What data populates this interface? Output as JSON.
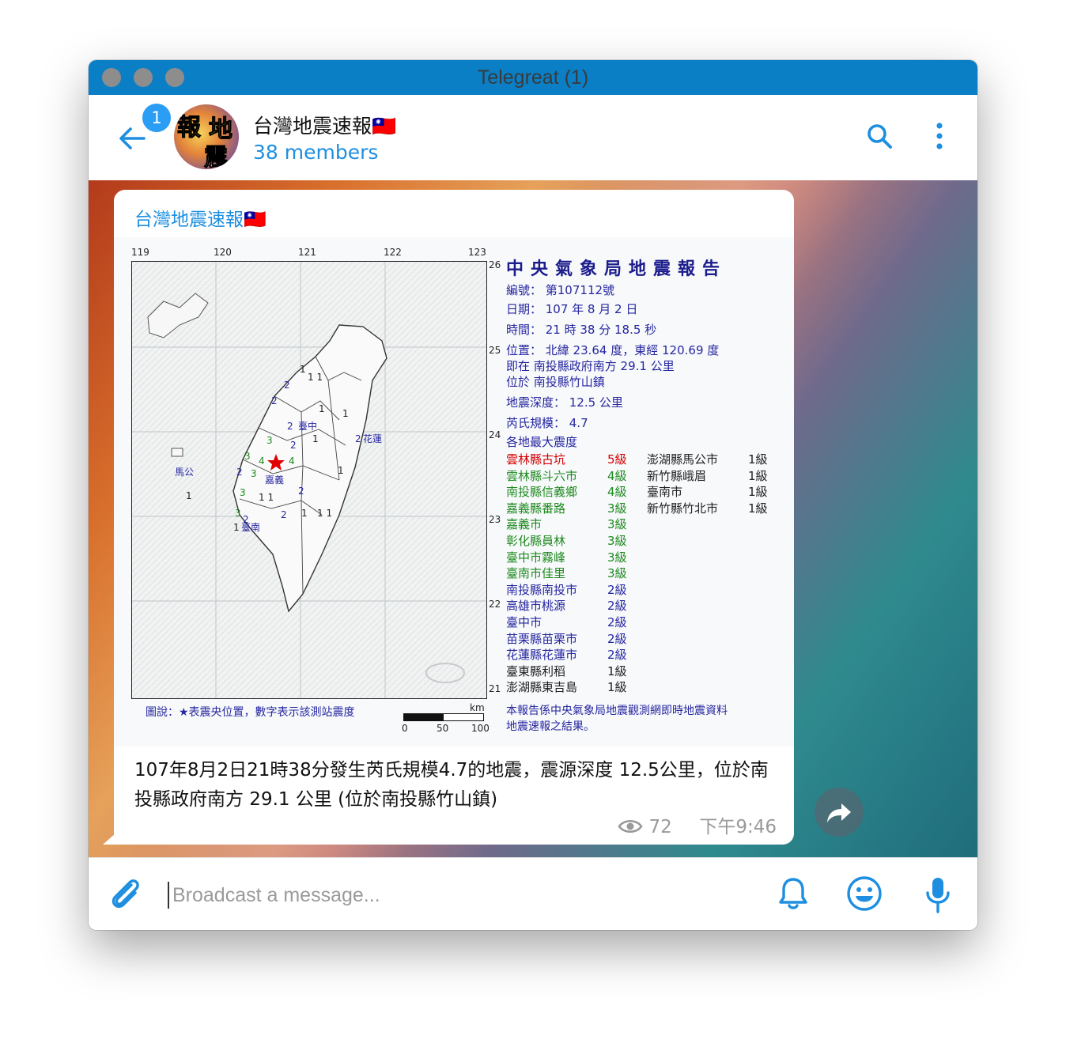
{
  "window": {
    "title": "Telegreat (1)"
  },
  "header": {
    "unread_badge": "1",
    "chat_name": "台灣地震速報🇹🇼",
    "members": "38 members",
    "avatar_chars": [
      "報",
      "地",
      "震"
    ]
  },
  "message": {
    "sender": "台灣地震速報🇹🇼",
    "caption": "107年8月2日21時38分發生芮氏規模4.7的地震，震源深度 12.5公里，位於南投縣政府南方  29.1  公里 (位於南投縣竹山鎮)",
    "views": "72",
    "time": "下午9:46"
  },
  "report": {
    "title": "中央氣象局地震報告",
    "lon_ticks": [
      "119",
      "120",
      "121",
      "122",
      "123"
    ],
    "lat_ticks": [
      "26",
      "25",
      "24",
      "23",
      "22",
      "21"
    ],
    "number": "編號：  第107112號",
    "date": "日期：  107  年  8  月  2  日",
    "time": "時間：  21  時  38  分  18.5  秒",
    "position": "位置：  北緯  23.64  度，東經  120.69  度",
    "position2": "即在  南投縣政府南方  29.1  公里",
    "position3": "位於  南投縣竹山鎮",
    "depth": "地震深度：  12.5  公里",
    "magnitude": "芮氏規模：  4.7",
    "intensity_heading": "各地最大震度",
    "intensities_left": [
      {
        "place": "雲林縣古坑",
        "level": "5級",
        "color": "#d40000"
      },
      {
        "place": "雲林縣斗六市",
        "level": "4級",
        "color": "#1f8a1f"
      },
      {
        "place": "南投縣信義鄉",
        "level": "4級",
        "color": "#1f8a1f"
      },
      {
        "place": "嘉義縣番路",
        "level": "3級",
        "color": "#1f8a1f"
      },
      {
        "place": "嘉義市",
        "level": "3級",
        "color": "#1f8a1f"
      },
      {
        "place": "彰化縣員林",
        "level": "3級",
        "color": "#1f8a1f"
      },
      {
        "place": "臺中市霧峰",
        "level": "3級",
        "color": "#1f8a1f"
      },
      {
        "place": "臺南市佳里",
        "level": "3級",
        "color": "#1f8a1f"
      },
      {
        "place": "南投縣南投市",
        "level": "2級",
        "color": "#2626a0"
      },
      {
        "place": "高雄市桃源",
        "level": "2級",
        "color": "#2626a0"
      },
      {
        "place": "臺中市",
        "level": "2級",
        "color": "#2626a0"
      },
      {
        "place": "苗栗縣苗栗市",
        "level": "2級",
        "color": "#2626a0"
      },
      {
        "place": "花蓮縣花蓮市",
        "level": "2級",
        "color": "#2626a0"
      },
      {
        "place": "臺東縣利稻",
        "level": "1級",
        "color": "#222222"
      },
      {
        "place": "澎湖縣東吉島",
        "level": "1級",
        "color": "#222222"
      }
    ],
    "intensities_right": [
      {
        "place": "澎湖縣馬公市",
        "level": "1級",
        "color": "#222222"
      },
      {
        "place": "新竹縣峨眉",
        "level": "1級",
        "color": "#222222"
      },
      {
        "place": "臺南市",
        "level": "1級",
        "color": "#222222"
      },
      {
        "place": "新竹縣竹北市",
        "level": "1級",
        "color": "#222222"
      }
    ],
    "legend": "圖說：★表震央位置，數字表示該測站震度",
    "scale_unit": "km",
    "scale_ticks": [
      "0",
      "50",
      "100"
    ],
    "footnote1": "本報告係中央氣象局地震觀測網即時地震資料",
    "footnote2": "地震速報之結果。",
    "map_labels": [
      "花蓮",
      "嘉義",
      "馬公",
      "臺中",
      "臺南"
    ]
  },
  "input": {
    "placeholder": "Broadcast a message..."
  },
  "colors": {
    "titlebar": "#0a7fc6",
    "accent": "#1e8fe0",
    "badge": "#2a9df4"
  },
  "icons": [
    "back-arrow-icon",
    "search-icon",
    "more-vertical-icon",
    "paperclip-icon",
    "bell-icon",
    "smile-icon",
    "microphone-icon",
    "share-icon",
    "eye-icon"
  ]
}
